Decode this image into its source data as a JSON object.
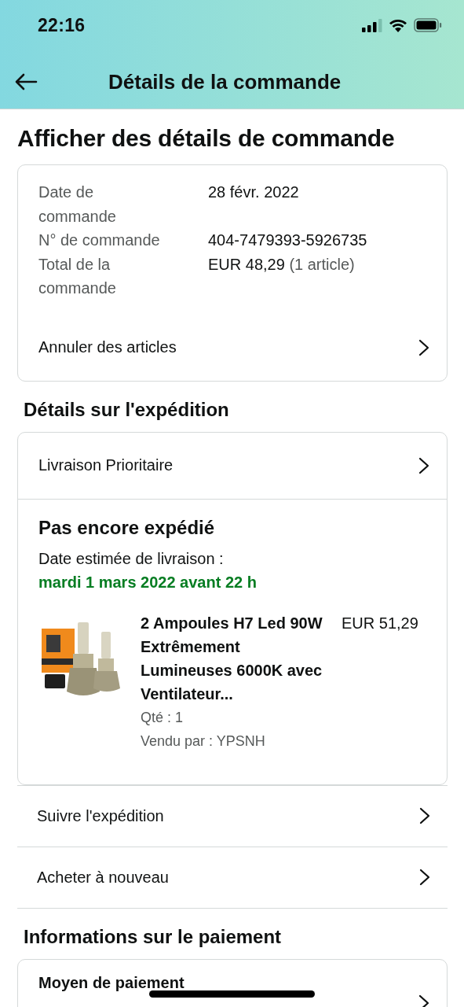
{
  "status_bar": {
    "time": "22:16"
  },
  "header": {
    "title": "Détails de la commande"
  },
  "page_title": "Afficher des détails de commande",
  "order_summary": {
    "fields": [
      {
        "label": "Date de commande",
        "value": "28 févr. 2022"
      },
      {
        "label": "N° de commande",
        "value": "404-7479393-5926735"
      },
      {
        "label": "Total de la commande",
        "value": "EUR 48,29",
        "note": "(1 article)"
      }
    ],
    "action": "Annuler des articles"
  },
  "shipping": {
    "heading": "Détails sur l'expédition",
    "method": "Livraison Prioritaire",
    "status": "Pas encore expédié",
    "estimate_label": "Date estimée de livraison :",
    "estimate_date": "mardi 1 mars 2022 avant 22 h",
    "item": {
      "kind": "picture",
      "title": "2 Ampoules H7 Led 90W Extrêmement Lumineuses 6000K avec Ventilateur...",
      "price": "EUR 51,29",
      "quantity": "Qté : 1",
      "seller": "Vendu par : YPSNH"
    }
  },
  "actions": [
    "Suivre l'expédition",
    "Acheter à nouveau"
  ],
  "payment": {
    "heading": "Informations sur le paiement",
    "row": "Moyen de paiement"
  }
}
